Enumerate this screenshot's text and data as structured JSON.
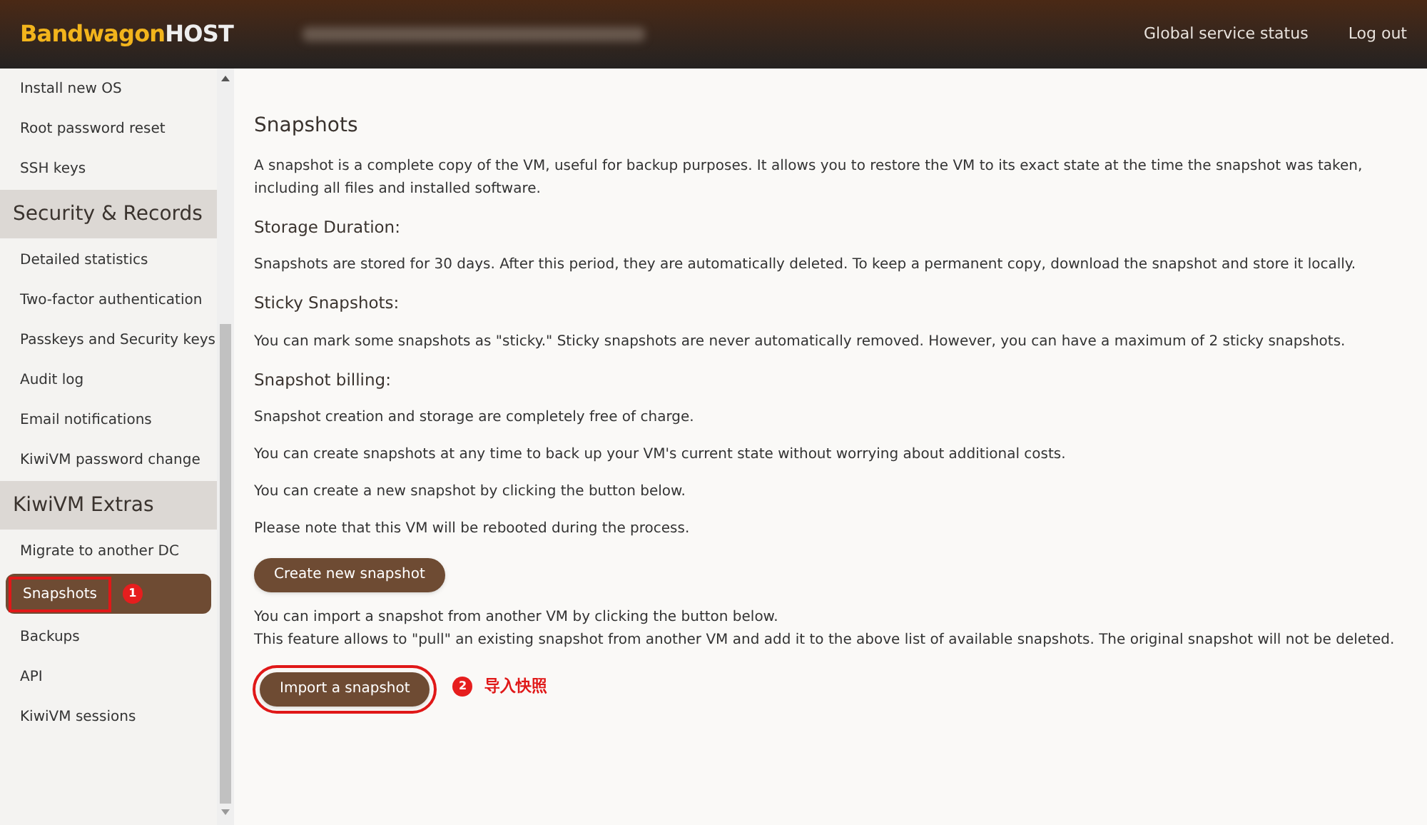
{
  "header": {
    "logo_primary": "Bandwagon",
    "logo_secondary": "HOST",
    "links": [
      "Global service status",
      "Log out"
    ]
  },
  "sidebar": {
    "items": [
      {
        "kind": "item",
        "label": "Install new OS",
        "selected": false
      },
      {
        "kind": "item",
        "label": "Root password reset",
        "selected": false
      },
      {
        "kind": "item",
        "label": "SSH keys",
        "selected": false
      },
      {
        "kind": "section",
        "label": "Security & Records"
      },
      {
        "kind": "item",
        "label": "Detailed statistics",
        "selected": false
      },
      {
        "kind": "item",
        "label": "Two-factor authentication",
        "selected": false
      },
      {
        "kind": "item",
        "label": "Passkeys and Security keys",
        "selected": false
      },
      {
        "kind": "item",
        "label": "Audit log",
        "selected": false
      },
      {
        "kind": "item",
        "label": "Email notifications",
        "selected": false
      },
      {
        "kind": "item",
        "label": "KiwiVM password change",
        "selected": false
      },
      {
        "kind": "section",
        "label": "KiwiVM Extras"
      },
      {
        "kind": "item",
        "label": "Migrate to another DC",
        "selected": false
      },
      {
        "kind": "item",
        "label": "Snapshots",
        "selected": true,
        "annotation": "1"
      },
      {
        "kind": "item",
        "label": "Backups",
        "selected": false
      },
      {
        "kind": "item",
        "label": "API",
        "selected": false
      },
      {
        "kind": "item",
        "label": "KiwiVM sessions",
        "selected": false
      }
    ]
  },
  "content": {
    "title": "Snapshots",
    "blocks": [
      {
        "kind": "para",
        "text": "A snapshot is a complete copy of the VM, useful for backup purposes. It allows you to restore the VM to its exact state at the time the snapshot was taken, including all files and installed software."
      },
      {
        "kind": "subheading",
        "text": "Storage Duration:"
      },
      {
        "kind": "para",
        "text": "Snapshots are stored for 30 days. After this period, they are automatically deleted. To keep a permanent copy, download the snapshot and store it locally."
      },
      {
        "kind": "subheading",
        "text": "Sticky Snapshots:"
      },
      {
        "kind": "para",
        "text": "You can mark some snapshots as \"sticky.\" Sticky snapshots are never automatically removed. However, you can have a maximum of 2 sticky snapshots."
      },
      {
        "kind": "subheading",
        "text": "Snapshot billing:"
      },
      {
        "kind": "para",
        "text": "Snapshot creation and storage are completely free of charge."
      },
      {
        "kind": "para",
        "text": "You can create snapshots at any time to back up your VM's current state without worrying about additional costs."
      },
      {
        "kind": "para",
        "text": "You can create a new snapshot by clicking the button below."
      },
      {
        "kind": "para",
        "text": "Please note that this VM will be rebooted during the process."
      },
      {
        "kind": "button",
        "text": "Create new snapshot"
      },
      {
        "kind": "line",
        "text": "You can import a snapshot from another VM by clicking the button below."
      },
      {
        "kind": "para",
        "text": "This feature allows to \"pull\" an existing snapshot from another VM and add it to the above list of available snapshots. The original snapshot will not be deleted."
      },
      {
        "kind": "button",
        "text": "Import a snapshot",
        "annotation": "2",
        "note": "导入快照"
      }
    ]
  }
}
